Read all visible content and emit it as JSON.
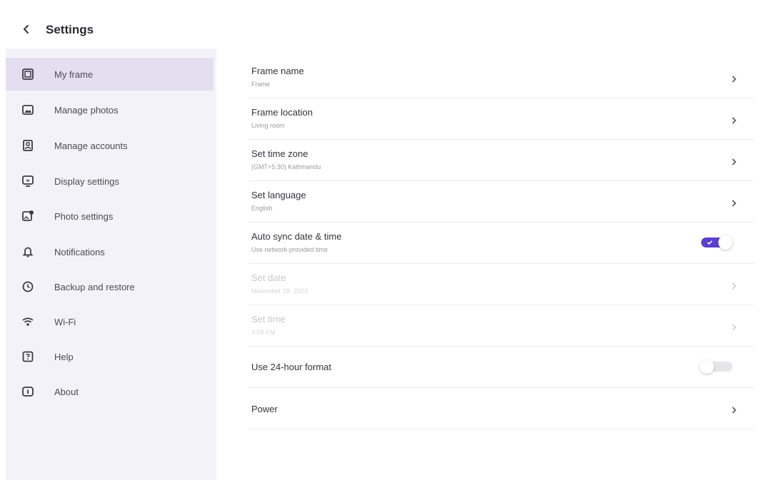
{
  "header": {
    "title": "Settings",
    "back_icon": "chevron-left-icon"
  },
  "sidebar": {
    "items": [
      {
        "label": "My frame",
        "icon": "frame-icon",
        "active": true
      },
      {
        "label": "Manage photos",
        "icon": "photos-icon",
        "active": false
      },
      {
        "label": "Manage accounts",
        "icon": "accounts-icon",
        "active": false
      },
      {
        "label": "Display settings",
        "icon": "display-icon",
        "active": false
      },
      {
        "label": "Photo settings",
        "icon": "photo-settings-icon",
        "active": false
      },
      {
        "label": "Notifications",
        "icon": "bell-icon",
        "active": false
      },
      {
        "label": "Backup and restore",
        "icon": "history-icon",
        "active": false
      },
      {
        "label": "Wi-Fi",
        "icon": "wifi-icon",
        "active": false
      },
      {
        "label": "Help",
        "icon": "help-icon",
        "active": false
      },
      {
        "label": "About",
        "icon": "info-icon",
        "active": false
      }
    ]
  },
  "settings": {
    "frame_name": {
      "title": "Frame name",
      "subtitle": "Frame"
    },
    "frame_location": {
      "title": "Frame location",
      "subtitle": "Living room"
    },
    "time_zone": {
      "title": "Set time zone",
      "subtitle": "(GMT+5:30) Kathmandu"
    },
    "language": {
      "title": "Set language",
      "subtitle": "English"
    },
    "auto_sync": {
      "title": "Auto sync date & time",
      "subtitle": "Use network-provided time",
      "enabled": true
    },
    "set_date": {
      "title": "Set date",
      "subtitle": "November 29, 2023",
      "disabled": true
    },
    "set_time": {
      "title": "Set time",
      "subtitle": "3:09 PM",
      "disabled": true
    },
    "hour_format": {
      "title": "Use 24-hour format",
      "enabled": false
    },
    "power": {
      "title": "Power"
    }
  },
  "colors": {
    "accent": "#5b3fd1",
    "sidebar_bg": "#f4f2f9",
    "active_bg": "#e3dff1"
  }
}
